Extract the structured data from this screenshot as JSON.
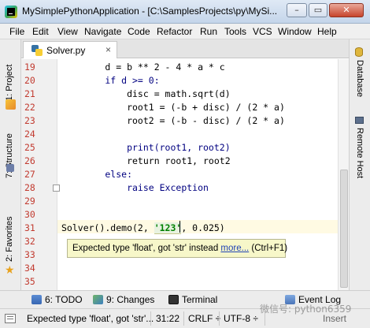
{
  "window": {
    "title": "MySimplePythonApplication - [C:\\SamplesProjects\\py\\MySi...",
    "minimize": "–",
    "maximize": "▭",
    "close": "✕"
  },
  "menu": [
    "File",
    "Edit",
    "View",
    "Navigate",
    "Code",
    "Refactor",
    "Run",
    "Tools",
    "VCS",
    "Window",
    "Help"
  ],
  "left_tools": {
    "project": "1: Project",
    "structure": "7: Structure",
    "favorites": "2: Favorites"
  },
  "right_tools": {
    "database": "Database",
    "remote_host": "Remote Host"
  },
  "editor_tab": {
    "name": "Solver.py",
    "close": "×"
  },
  "line_numbers": [
    "19",
    "20",
    "21",
    "22",
    "23",
    "24",
    "25",
    "26",
    "27",
    "28",
    "29",
    "30",
    "31",
    "32",
    "33",
    "34",
    "35"
  ],
  "code": {
    "l19": "        d = b ** 2 - 4 * a * c",
    "l20": "        if d >= 0:",
    "l21": "            disc = math.sqrt(d)",
    "l22": "            root1 = (-b + disc) / (2 * a)",
    "l23": "            root2 = (-b - disc) / (2 * a)",
    "l25": "            print(root1, root2)",
    "l26": "            return root1, root2",
    "l27": "        else:",
    "l28": "            raise Exception",
    "l31_a": "Solver().demo(2, ",
    "l31_str": "'123'",
    "l31_b": ", 0.025)"
  },
  "tooltip": {
    "text": "Expected type 'float', got 'str' instead ",
    "link": "more...",
    "shortcut": " (Ctrl+F1)"
  },
  "bottom_tools": {
    "todo": "6: TODO",
    "changes": "9: Changes",
    "terminal": "Terminal",
    "event_log": "Event Log"
  },
  "status": {
    "message": "Expected type 'float', got 'str'...",
    "position": "31:22",
    "line_sep": "CRLF ÷",
    "encoding": "UTF-8 ÷",
    "mode": "Insert"
  },
  "watermark": "微信号: python6359",
  "colors": {
    "line_number": "#c23b30",
    "keyword": "#000080",
    "number": "#0000ff",
    "string": "#008000",
    "tooltip_bg": "#f7f7c9",
    "current_line": "#fffae3"
  }
}
